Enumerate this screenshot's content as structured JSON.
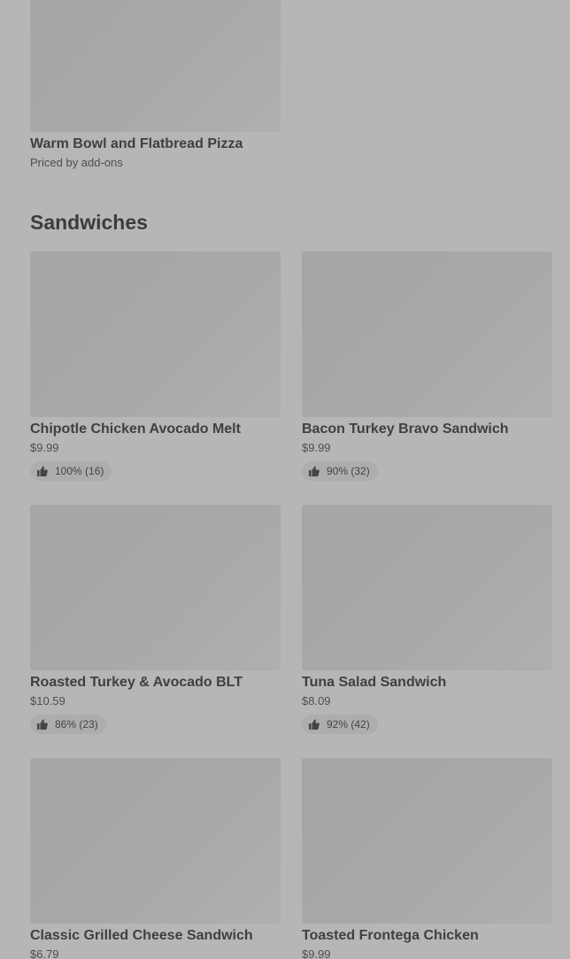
{
  "top_item": {
    "name": "Warm Bowl and Flatbread Pizza",
    "subtitle": "Priced by add-ons"
  },
  "section": {
    "title": "Sandwiches"
  },
  "items": [
    {
      "name": "Chipotle Chicken Avocado Melt",
      "price": "$9.99",
      "rating": "100% (16)"
    },
    {
      "name": "Bacon Turkey Bravo Sandwich",
      "price": "$9.99",
      "rating": "90% (32)"
    },
    {
      "name": "Roasted Turkey & Avocado BLT",
      "price": "$10.59",
      "rating": "86% (23)"
    },
    {
      "name": "Tuna Salad Sandwich",
      "price": "$8.09",
      "rating": "92% (42)"
    },
    {
      "name": "Classic Grilled Cheese Sandwich",
      "price": "$6.79",
      "rating": ""
    },
    {
      "name": "Toasted Frontega Chicken",
      "price": "$9.99",
      "rating": ""
    }
  ],
  "icons": {
    "rating": "thumbs-up-icon"
  },
  "colors": {
    "background": "#b6b6b6",
    "image_placeholder": "#a8a8a8",
    "text": "#404040"
  }
}
